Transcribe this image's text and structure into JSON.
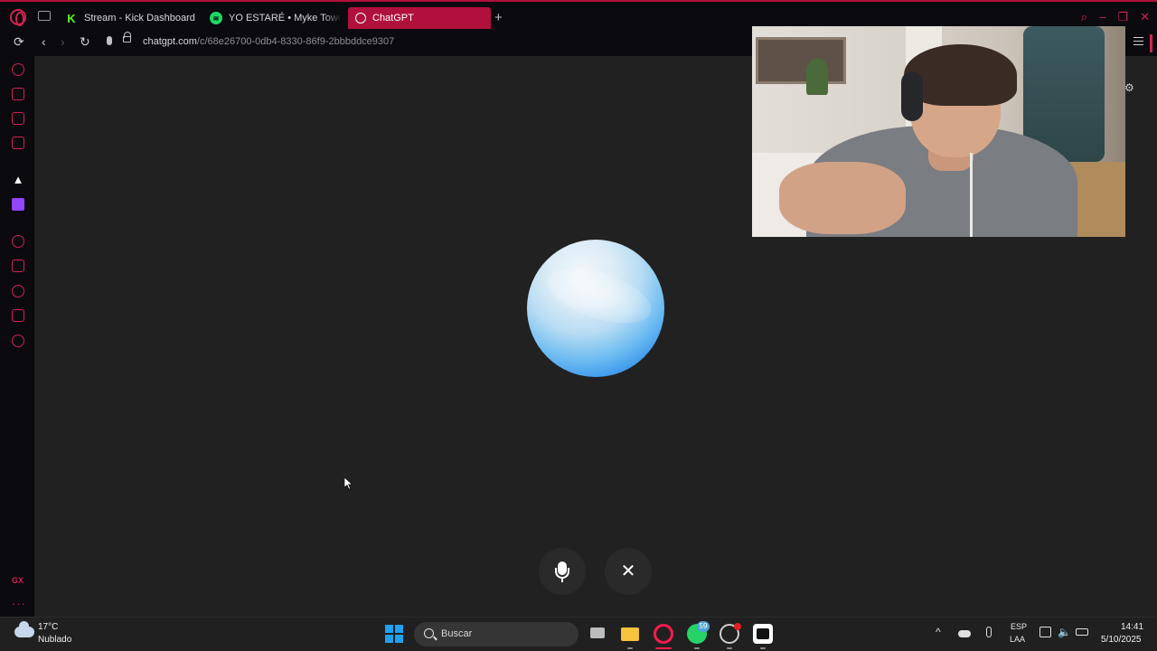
{
  "browser": {
    "tabs": [
      {
        "label": "Stream - Kick Dashboard",
        "icon": "kick-icon",
        "fav": "K"
      },
      {
        "label": "YO ESTARÉ • Myke Towers",
        "icon": "spotify-icon"
      },
      {
        "label": "ChatGPT",
        "icon": "chatgpt-icon",
        "active": true
      }
    ],
    "new_tab": "+",
    "url_host": "chatgpt.com",
    "url_path": "/c/68e26700-0db4-8330-86f9-2bbbddce9307",
    "accent_color": "#d1234f",
    "active_tab_color": "#b0103c"
  },
  "sidebar": {
    "icons": [
      "refresh-icon",
      "aria-icon",
      "player-icon",
      "messenger-icon",
      "feather-icon",
      "twitch-icon",
      "record-icon",
      "pin-icon",
      "history-icon",
      "extensions-icon",
      "settings-icon"
    ],
    "gx_label": "GX",
    "more_label": "···"
  },
  "voice_mode": {
    "orb_color": "#4aa8f0",
    "close_glyph": "✕"
  },
  "webcam": {
    "present": true
  },
  "taskbar": {
    "weather_temp": "17°C",
    "weather_desc": "Nublado",
    "search_label": "Buscar",
    "whatsapp_badge": "59",
    "lang_line1": "ESP",
    "lang_line2": "LAA",
    "time": "14:41",
    "date": "5/10/2025"
  }
}
